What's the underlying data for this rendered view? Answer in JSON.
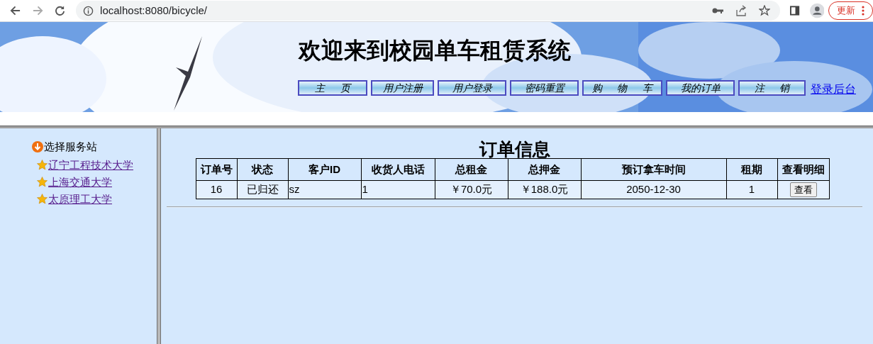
{
  "browser": {
    "url": "localhost:8080/bicycle/",
    "update_button": "更新"
  },
  "header": {
    "title": "欢迎来到校园单车租赁系统",
    "nav": [
      {
        "label": "主 页"
      },
      {
        "label": "用户注册"
      },
      {
        "label": "用户登录"
      },
      {
        "label": "密码重置"
      },
      {
        "label": "购 物 车"
      },
      {
        "label": "我的订单"
      },
      {
        "label": "注 销"
      }
    ],
    "admin_link": "登录后台"
  },
  "sidebar": {
    "heading": "选择服务站",
    "stations": [
      "辽宁工程技术大学",
      "上海交通大学",
      "太原理工大学"
    ]
  },
  "orders": {
    "title": "订单信息",
    "columns": [
      "订单号",
      "状态",
      "客户ID",
      "收货人电话",
      "总租金",
      "总押金",
      "预订拿车时间",
      "租期",
      "查看明细"
    ],
    "rows": [
      {
        "cells": [
          "16",
          "已归还",
          "sz",
          "1",
          "￥70.0元",
          "￥188.0元",
          "2050-12-30",
          "1"
        ],
        "action": "查看"
      }
    ]
  }
}
